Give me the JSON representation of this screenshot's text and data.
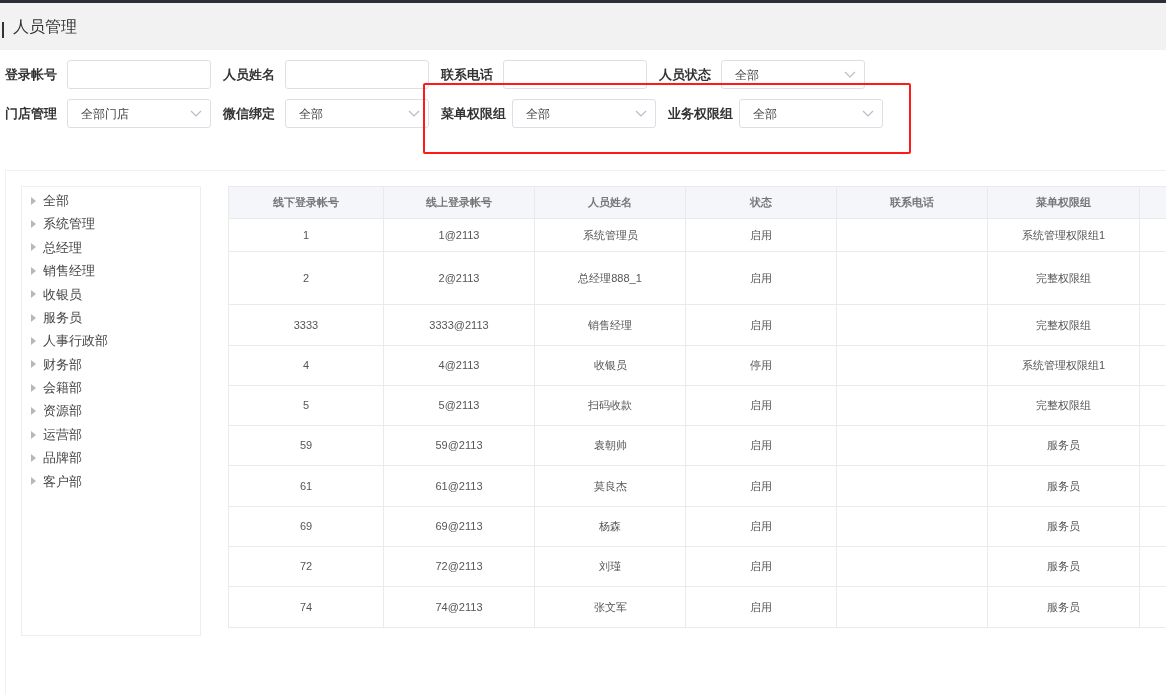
{
  "page": {
    "title": "人员管理"
  },
  "filters": [
    [
      {
        "label": "登录帐号",
        "kind": "text"
      },
      {
        "label": "人员姓名",
        "kind": "text"
      },
      {
        "label": "联系电话",
        "kind": "text"
      },
      {
        "label": "人员状态",
        "kind": "select",
        "value": "全部"
      }
    ],
    [
      {
        "label": "门店管理",
        "kind": "select",
        "value": "全部门店"
      },
      {
        "label": "微信绑定",
        "kind": "select",
        "value": "全部"
      },
      {
        "label": "菜单权限组",
        "kind": "select",
        "value": "全部"
      },
      {
        "label": "业务权限组",
        "kind": "select",
        "value": "全部"
      }
    ]
  ],
  "tree": [
    {
      "label": "全部",
      "expanded": false
    },
    {
      "label": "系统管理",
      "expanded": false
    },
    {
      "label": "总经理",
      "expanded": false
    },
    {
      "label": "销售经理",
      "expanded": false
    },
    {
      "label": "收银员",
      "expanded": false
    },
    {
      "label": "服务员",
      "expanded": false
    },
    {
      "label": "人事行政部",
      "expanded": false
    },
    {
      "label": "财务部",
      "expanded": false
    },
    {
      "label": "会籍部",
      "expanded": false
    },
    {
      "label": "资源部",
      "expanded": false
    },
    {
      "label": "运营部",
      "expanded": false
    },
    {
      "label": "品牌部",
      "expanded": false
    },
    {
      "label": "客户部",
      "expanded": false
    }
  ],
  "table": {
    "columns": [
      "线下登录帐号",
      "线上登录帐号",
      "人员姓名",
      "状态",
      "联系电话",
      "菜单权限组"
    ],
    "rows": [
      [
        "1",
        "1@2113",
        "系统管理员",
        "启用",
        "",
        "系统管理权限组1"
      ],
      [
        "2",
        "2@2113",
        "总经理888_1",
        "启用",
        "",
        "完整权限组"
      ],
      [
        "3333",
        "3333@2113",
        "销售经理",
        "启用",
        "",
        "完整权限组"
      ],
      [
        "4",
        "4@2113",
        "收银员",
        "停用",
        "",
        "系统管理权限组1"
      ],
      [
        "5",
        "5@2113",
        "扫码收款",
        "启用",
        "",
        "完整权限组"
      ],
      [
        "59",
        "59@2113",
        "袁朝帅",
        "启用",
        "",
        "服务员"
      ],
      [
        "61",
        "61@2113",
        "莫良杰",
        "启用",
        "",
        "服务员"
      ],
      [
        "69",
        "69@2113",
        "杨森",
        "启用",
        "",
        "服务员"
      ],
      [
        "72",
        "72@2113",
        "刘瑾",
        "启用",
        "",
        "服务员"
      ],
      [
        "74",
        "74@2113",
        "张文军",
        "启用",
        "",
        "服务员"
      ]
    ]
  }
}
